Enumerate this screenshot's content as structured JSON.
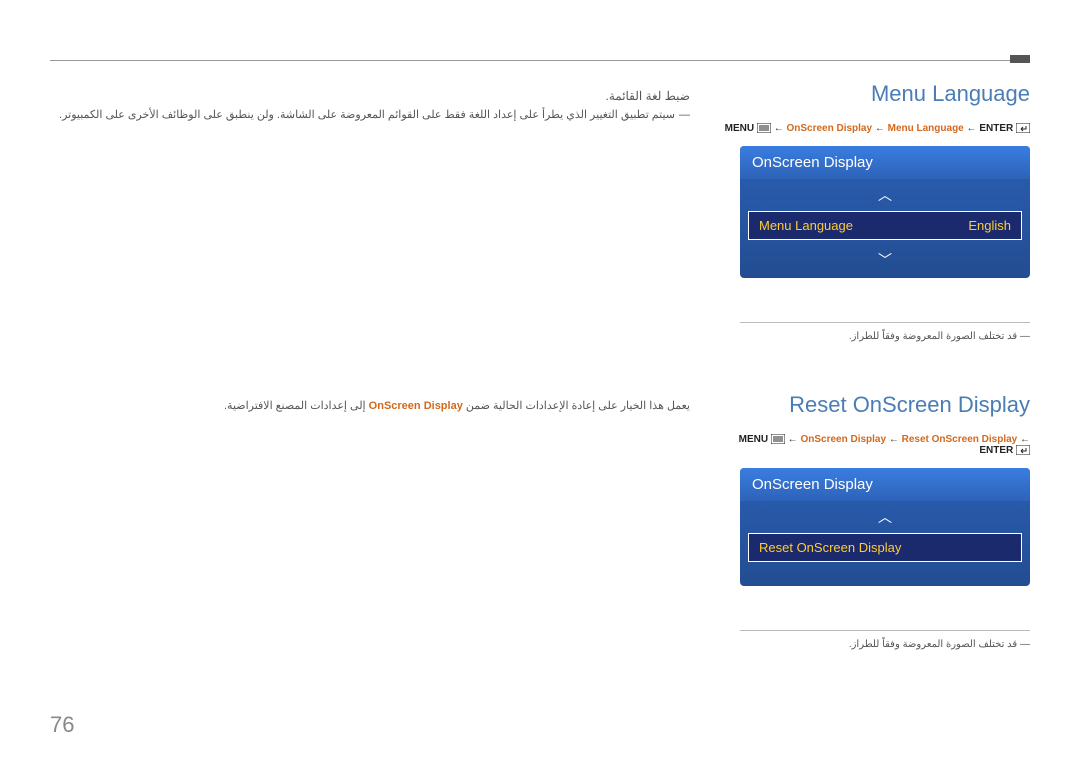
{
  "page_number": "76",
  "section1": {
    "title": "Menu Language",
    "breadcrumb": {
      "enter": "ENTER",
      "p1": "Menu Language",
      "p2": "OnScreen Display",
      "menu": "MENU",
      "arrow": "←"
    },
    "panel": {
      "header": "OnScreen Display",
      "row_label": "Menu Language",
      "row_value": "English"
    },
    "note": "قد تختلف الصورة المعروضة وفقاً للطراز.",
    "ar_title": "ضبط لغة القائمة.",
    "ar_body_prefix": "سيتم تطبيق التغيير الذي يطرأ على إعداد اللغة فقط على القوائم المعروضة على الشاشة. ولن ينطبق على الوظائف الأخرى على الكمبيوتر."
  },
  "section2": {
    "title": "Reset OnScreen Display",
    "breadcrumb": {
      "enter": "ENTER",
      "p1": "Reset OnScreen Display",
      "p2": "OnScreen Display",
      "menu": "MENU",
      "arrow": "←"
    },
    "panel": {
      "header": "OnScreen Display",
      "row_label": "Reset OnScreen Display"
    },
    "note": "قد تختلف الصورة المعروضة وفقاً للطراز.",
    "ar_body_prefix": "يعمل هذا الخيار على إعادة الإعدادات الحالية ضمن ",
    "ar_body_link": "OnScreen Display",
    "ar_body_suffix": " إلى إعدادات المصنع الافتراضية."
  }
}
